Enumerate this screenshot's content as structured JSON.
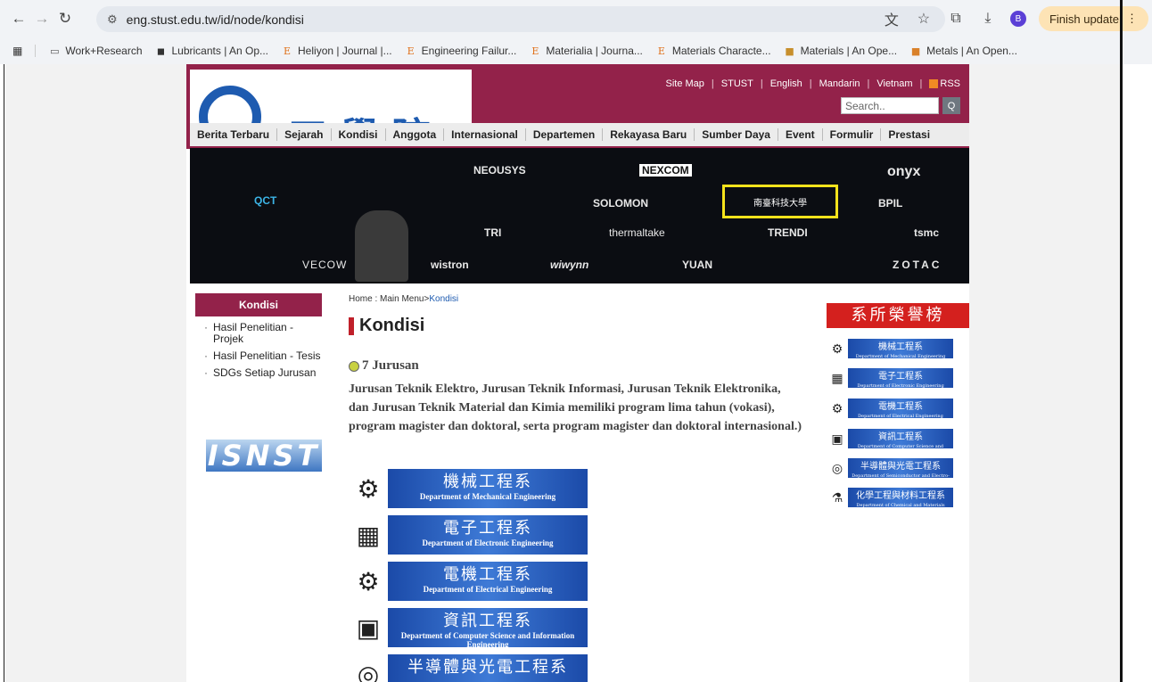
{
  "browser": {
    "url": "eng.stust.edu.tw/id/node/kondisi",
    "finish_update": "Finish update",
    "avatar_letter": "B",
    "bookmarks": [
      "Work+Research",
      "Lubricants | An Op...",
      "Heliyon | Journal |...",
      "Engineering Failur...",
      "Materialia | Journa...",
      "Materials Characte...",
      "Materials | An Ope...",
      "Metals | An Open..."
    ]
  },
  "header": {
    "logo_text": "工學院",
    "links": [
      "Site Map",
      "STUST",
      "English",
      "Mandarin",
      "Vietnam",
      "RSS"
    ],
    "search_placeholder": "Search..",
    "search_button": "Q"
  },
  "menu": [
    "Berita Terbaru",
    "Sejarah",
    "Kondisi",
    "Anggota",
    "Internasional",
    "Departemen",
    "Rekayasa Baru",
    "Sumber Daya",
    "Event",
    "Formulir",
    "Prestasi"
  ],
  "banner": {
    "logos": [
      "NEOUSYS",
      "NEXCOM",
      "onyx",
      "QCT",
      "SOLOMON",
      "BPIL",
      "TRI",
      "thermaltake",
      "TRENDI",
      "tsmc",
      "VECOW",
      "wistron",
      "wiwynn",
      "YUAN",
      "ZOTAC"
    ],
    "highlight": "南臺科技大學"
  },
  "sidebar": {
    "title": "Kondisi",
    "items": [
      "Hasil Penelitian - Projek",
      "Hasil Penelitian - Tesis",
      "SDGs Setiap Jurusan"
    ],
    "isnst": "ISNST"
  },
  "main": {
    "crumb_home": "Home",
    "crumb_sep": " : Main Menu>",
    "crumb_current": "Kondisi",
    "title": "Kondisi",
    "subheading": "7 Jurusan",
    "description": "Jurusan Teknik Elektro, Jurusan Teknik Informasi, Jurusan Teknik Elektronika, dan Jurusan Teknik Material dan Kimia memiliki program lima tahun (vokasi), program magister dan doktoral, serta program magister dan doktoral internasional.)",
    "departments": [
      {
        "zh": "機械工程系",
        "en": "Department of Mechanical Engineering",
        "icon": "⚙"
      },
      {
        "zh": "電子工程系",
        "en": "Department of Electronic Engineering",
        "icon": "▦"
      },
      {
        "zh": "電機工程系",
        "en": "Department of Electrical Engineering",
        "icon": "⚙"
      },
      {
        "zh": "資訊工程系",
        "en": "Department of Computer Science and Information Engineering",
        "icon": "▣"
      },
      {
        "zh": "半導體與光電工程系",
        "en": "",
        "icon": "◎"
      }
    ]
  },
  "honor": {
    "title": "系所榮譽榜",
    "items": [
      {
        "zh": "機械工程系",
        "en": "Department of Mechanical Engineering",
        "icon": "⚙"
      },
      {
        "zh": "電子工程系",
        "en": "Department of Electronic Engineering",
        "icon": "▦"
      },
      {
        "zh": "電機工程系",
        "en": "Department of Electrical Engineering",
        "icon": "⚙"
      },
      {
        "zh": "資訊工程系",
        "en": "Department of Computer Science and Information Engineering",
        "icon": "▣"
      },
      {
        "zh": "半導體與光電工程系",
        "en": "Department of Semiconductor and Electro-Optical Engineering",
        "icon": "◎"
      },
      {
        "zh": "化學工程與材料工程系",
        "en": "Department of Chemical and Materials Engineering",
        "icon": "⚗"
      }
    ]
  }
}
